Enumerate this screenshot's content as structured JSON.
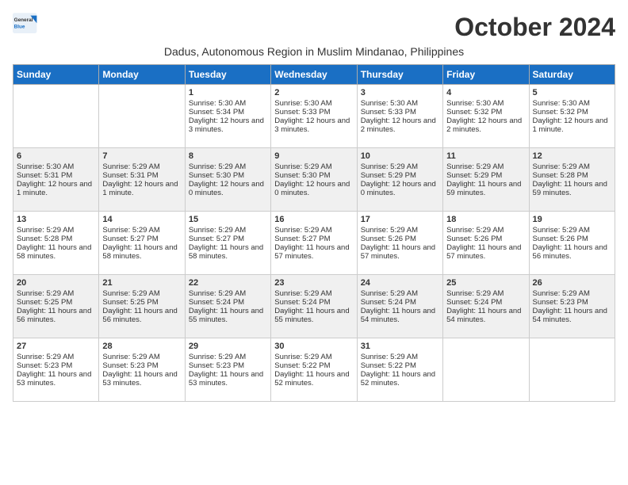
{
  "logo": {
    "line1": "General",
    "line2": "Blue"
  },
  "title": "October 2024",
  "subtitle": "Dadus, Autonomous Region in Muslim Mindanao, Philippines",
  "headers": [
    "Sunday",
    "Monday",
    "Tuesday",
    "Wednesday",
    "Thursday",
    "Friday",
    "Saturday"
  ],
  "weeks": [
    {
      "shaded": false,
      "days": [
        {
          "num": "",
          "text": ""
        },
        {
          "num": "",
          "text": ""
        },
        {
          "num": "1",
          "text": "Sunrise: 5:30 AM\nSunset: 5:34 PM\nDaylight: 12 hours and 3 minutes."
        },
        {
          "num": "2",
          "text": "Sunrise: 5:30 AM\nSunset: 5:33 PM\nDaylight: 12 hours and 3 minutes."
        },
        {
          "num": "3",
          "text": "Sunrise: 5:30 AM\nSunset: 5:33 PM\nDaylight: 12 hours and 2 minutes."
        },
        {
          "num": "4",
          "text": "Sunrise: 5:30 AM\nSunset: 5:32 PM\nDaylight: 12 hours and 2 minutes."
        },
        {
          "num": "5",
          "text": "Sunrise: 5:30 AM\nSunset: 5:32 PM\nDaylight: 12 hours and 1 minute."
        }
      ]
    },
    {
      "shaded": true,
      "days": [
        {
          "num": "6",
          "text": "Sunrise: 5:30 AM\nSunset: 5:31 PM\nDaylight: 12 hours and 1 minute."
        },
        {
          "num": "7",
          "text": "Sunrise: 5:29 AM\nSunset: 5:31 PM\nDaylight: 12 hours and 1 minute."
        },
        {
          "num": "8",
          "text": "Sunrise: 5:29 AM\nSunset: 5:30 PM\nDaylight: 12 hours and 0 minutes."
        },
        {
          "num": "9",
          "text": "Sunrise: 5:29 AM\nSunset: 5:30 PM\nDaylight: 12 hours and 0 minutes."
        },
        {
          "num": "10",
          "text": "Sunrise: 5:29 AM\nSunset: 5:29 PM\nDaylight: 12 hours and 0 minutes."
        },
        {
          "num": "11",
          "text": "Sunrise: 5:29 AM\nSunset: 5:29 PM\nDaylight: 11 hours and 59 minutes."
        },
        {
          "num": "12",
          "text": "Sunrise: 5:29 AM\nSunset: 5:28 PM\nDaylight: 11 hours and 59 minutes."
        }
      ]
    },
    {
      "shaded": false,
      "days": [
        {
          "num": "13",
          "text": "Sunrise: 5:29 AM\nSunset: 5:28 PM\nDaylight: 11 hours and 58 minutes."
        },
        {
          "num": "14",
          "text": "Sunrise: 5:29 AM\nSunset: 5:27 PM\nDaylight: 11 hours and 58 minutes."
        },
        {
          "num": "15",
          "text": "Sunrise: 5:29 AM\nSunset: 5:27 PM\nDaylight: 11 hours and 58 minutes."
        },
        {
          "num": "16",
          "text": "Sunrise: 5:29 AM\nSunset: 5:27 PM\nDaylight: 11 hours and 57 minutes."
        },
        {
          "num": "17",
          "text": "Sunrise: 5:29 AM\nSunset: 5:26 PM\nDaylight: 11 hours and 57 minutes."
        },
        {
          "num": "18",
          "text": "Sunrise: 5:29 AM\nSunset: 5:26 PM\nDaylight: 11 hours and 57 minutes."
        },
        {
          "num": "19",
          "text": "Sunrise: 5:29 AM\nSunset: 5:26 PM\nDaylight: 11 hours and 56 minutes."
        }
      ]
    },
    {
      "shaded": true,
      "days": [
        {
          "num": "20",
          "text": "Sunrise: 5:29 AM\nSunset: 5:25 PM\nDaylight: 11 hours and 56 minutes."
        },
        {
          "num": "21",
          "text": "Sunrise: 5:29 AM\nSunset: 5:25 PM\nDaylight: 11 hours and 56 minutes."
        },
        {
          "num": "22",
          "text": "Sunrise: 5:29 AM\nSunset: 5:24 PM\nDaylight: 11 hours and 55 minutes."
        },
        {
          "num": "23",
          "text": "Sunrise: 5:29 AM\nSunset: 5:24 PM\nDaylight: 11 hours and 55 minutes."
        },
        {
          "num": "24",
          "text": "Sunrise: 5:29 AM\nSunset: 5:24 PM\nDaylight: 11 hours and 54 minutes."
        },
        {
          "num": "25",
          "text": "Sunrise: 5:29 AM\nSunset: 5:24 PM\nDaylight: 11 hours and 54 minutes."
        },
        {
          "num": "26",
          "text": "Sunrise: 5:29 AM\nSunset: 5:23 PM\nDaylight: 11 hours and 54 minutes."
        }
      ]
    },
    {
      "shaded": false,
      "days": [
        {
          "num": "27",
          "text": "Sunrise: 5:29 AM\nSunset: 5:23 PM\nDaylight: 11 hours and 53 minutes."
        },
        {
          "num": "28",
          "text": "Sunrise: 5:29 AM\nSunset: 5:23 PM\nDaylight: 11 hours and 53 minutes."
        },
        {
          "num": "29",
          "text": "Sunrise: 5:29 AM\nSunset: 5:23 PM\nDaylight: 11 hours and 53 minutes."
        },
        {
          "num": "30",
          "text": "Sunrise: 5:29 AM\nSunset: 5:22 PM\nDaylight: 11 hours and 52 minutes."
        },
        {
          "num": "31",
          "text": "Sunrise: 5:29 AM\nSunset: 5:22 PM\nDaylight: 11 hours and 52 minutes."
        },
        {
          "num": "",
          "text": ""
        },
        {
          "num": "",
          "text": ""
        }
      ]
    }
  ]
}
